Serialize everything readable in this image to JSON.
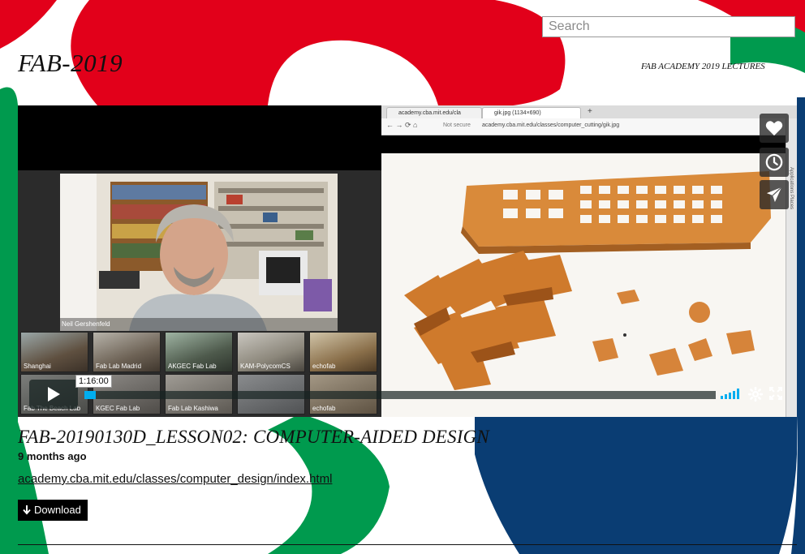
{
  "search": {
    "placeholder": "Search"
  },
  "site": {
    "title": "FAB-2019",
    "subtitle": "FAB ACADEMY 2019 LECTURES"
  },
  "colors": {
    "red": "#e2001a",
    "green": "#009a4e",
    "blue": "#0a3d73"
  },
  "player": {
    "webcam_label": "Neil Gershenfeld",
    "thumbnails": [
      "Shanghai",
      "Fab Lab Madrid",
      "AKGEC Fab Lab",
      "KAM-PolycomCS",
      "echofab",
      "Fab The Beach Lab",
      "KGEC Fab Lab",
      "Fab Lab Kashiwa",
      "echofab"
    ],
    "browser": {
      "tab1": "academy.cba.mit.edu/cla",
      "tab2": "gik.jpg (1134×690)",
      "secure_label": "Not secure",
      "url": "academy.cba.mit.edu/classes/computer_cutting/gik.jpg",
      "side_text": "Applications  Places"
    },
    "time_tooltip": "1:16:00",
    "progress_fraction": 0.018,
    "side_buttons": [
      "heart-icon",
      "clock-icon",
      "paper-plane-icon"
    ]
  },
  "video": {
    "title": "FAB-20190130D_LESSON02: COMPUTER-AIDED DESIGN",
    "age": "9 months ago",
    "link": "academy.cba.mit.edu/classes/computer_design/index.html",
    "download_label": "Download"
  }
}
